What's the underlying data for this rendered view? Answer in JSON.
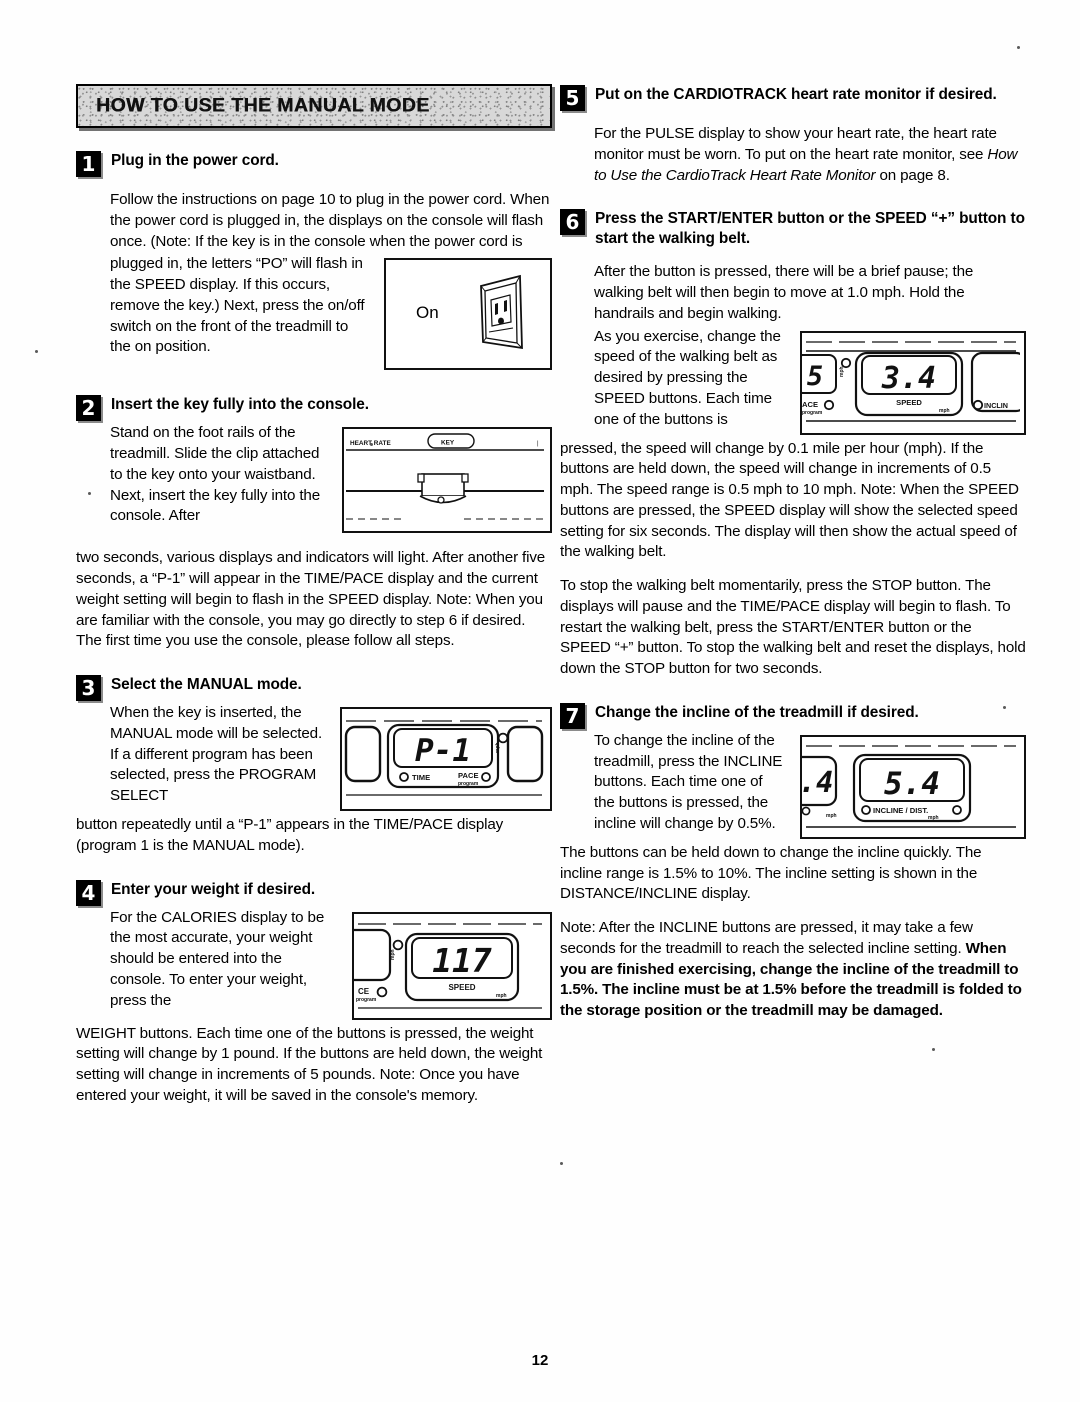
{
  "page": {
    "number": "12",
    "banner_title": "HOW TO USE THE MANUAL MODE"
  },
  "steps": [
    {
      "number": "1",
      "title": "Plug in the power cord.",
      "paragraphs": [
        "Follow the instructions on page 10 to plug in the power cord. When the power cord is plugged in, the displays on the console will flash once. (Note: If the key is in the console when the power cord is",
        "plugged in, the letters “PO” will flash in the SPEED display. If this occurs, remove the key.) Next, press the on/off switch on the front of the treadmill to the on position."
      ],
      "figure": {
        "name": "on-off-switch-figure",
        "label": "On"
      }
    },
    {
      "number": "2",
      "title": "Insert the key fully into the console.",
      "paragraphs": [
        "Stand on the foot rails of the treadmill. Slide the clip attached to the key onto your waistband. Next, insert the key fully into the console. After",
        "two seconds, various displays and indicators will light. After another five seconds, a “P-1” will appear in the TIME/PACE display and the current weight setting will begin to flash in the SPEED display. Note: When you are familiar with the console, you may go directly to step 6 if desired. The first time you use the console, please follow all steps."
      ],
      "figure": {
        "name": "key-insert-figure",
        "label_left": "HEART RATE",
        "label_center": "KEY"
      }
    },
    {
      "number": "3",
      "title": "Select the MANUAL mode.",
      "paragraphs": [
        "When the key is inserted, the MANUAL mode will be selected. If a different program has been selected, press the PROGRAM SELECT",
        "button repeatedly until a “P-1” appears in the TIME/PACE display (program 1 is the MANUAL mode)."
      ],
      "figure": {
        "name": "time-pace-display-figure",
        "value": "P-1",
        "label_left": "TIME",
        "label_right": "PACE",
        "label_right_sub": "program"
      }
    },
    {
      "number": "4",
      "title": "Enter your weight if desired.",
      "paragraphs": [
        "For the CALORIES display to be the most accurate, your weight should be entered into the console. To enter your weight, press the",
        "WEIGHT buttons. Each time one of the buttons is pressed, the weight setting will change by 1 pound. If the buttons are held down, the weight setting will change in increments of 5 pounds. Note: Once you have entered your weight, it will be saved in the console's memory."
      ],
      "figure": {
        "name": "weight-speed-display-figure",
        "value": "117",
        "label_center": "SPEED",
        "label_left": "CE",
        "label_unit": "mph"
      }
    },
    {
      "number": "5",
      "title": "Put on the CARDIOTRACK heart rate monitor if desired.",
      "paragraphs": [
        "For the PULSE display to show your heart rate, the heart rate monitor must be worn. To put on the heart rate monitor, see ",
        "How to Use the CardioTrack Heart Rate Monitor",
        " on page 8."
      ]
    },
    {
      "number": "6",
      "title": "Press the START/ENTER button or the SPEED “+” button to start the walking belt.",
      "paragraphs": [
        "After the button is pressed, there will be a brief pause; the walking belt will then begin to move at 1.0 mph. Hold the handrails and begin walking.",
        "As you exercise, change the speed of the walking belt as desired by pressing the SPEED buttons. Each time one of the buttons is",
        "pressed, the speed will change by 0.1 mile per hour (mph). If the buttons are held down, the speed will change in increments of 0.5 mph. The speed range is 0.5 mph to 10 mph. Note: When the SPEED buttons are pressed, the SPEED display will show the selected speed setting for six seconds. The display will then show the actual speed of the walking belt.",
        "To stop the walking belt momentarily, press the STOP button. The displays will pause and the TIME/PACE display will begin to flash. To restart the walking belt, press the START/ENTER button or the SPEED “+” button. To stop the walking belt and reset the displays, hold down the STOP button for two seconds."
      ],
      "figure": {
        "name": "speed-display-figure",
        "value": "3.4",
        "value_left": "5",
        "label_center": "SPEED",
        "label_left": "ACE",
        "label_left_sub": "program",
        "label_right": "INCLIN",
        "label_unit": "mph"
      }
    },
    {
      "number": "7",
      "title": "Change the incline of the treadmill if desired.",
      "paragraphs": [
        "To change the incline of the treadmill, press the INCLINE buttons. Each time one of the buttons is pressed, the incline will change by 0.5%.",
        "The buttons can be held down to change the incline quickly. The incline range is 1.5% to 10%. The incline setting is shown in the DISTANCE/INCLINE display.",
        "Note: After the INCLINE buttons are pressed, it may take a few seconds for the treadmill to reach the selected incline setting. ",
        "When you are finished exercising, change the incline of the treadmill to 1.5%. The incline must be at 1.5% before the treadmill is folded to the storage position or the treadmill may be damaged."
      ],
      "figure": {
        "name": "incline-display-figure",
        "value": "5.4",
        "value_left": "4",
        "label_center": "INCLINE / DIST.",
        "label_unit": "mph"
      }
    }
  ]
}
